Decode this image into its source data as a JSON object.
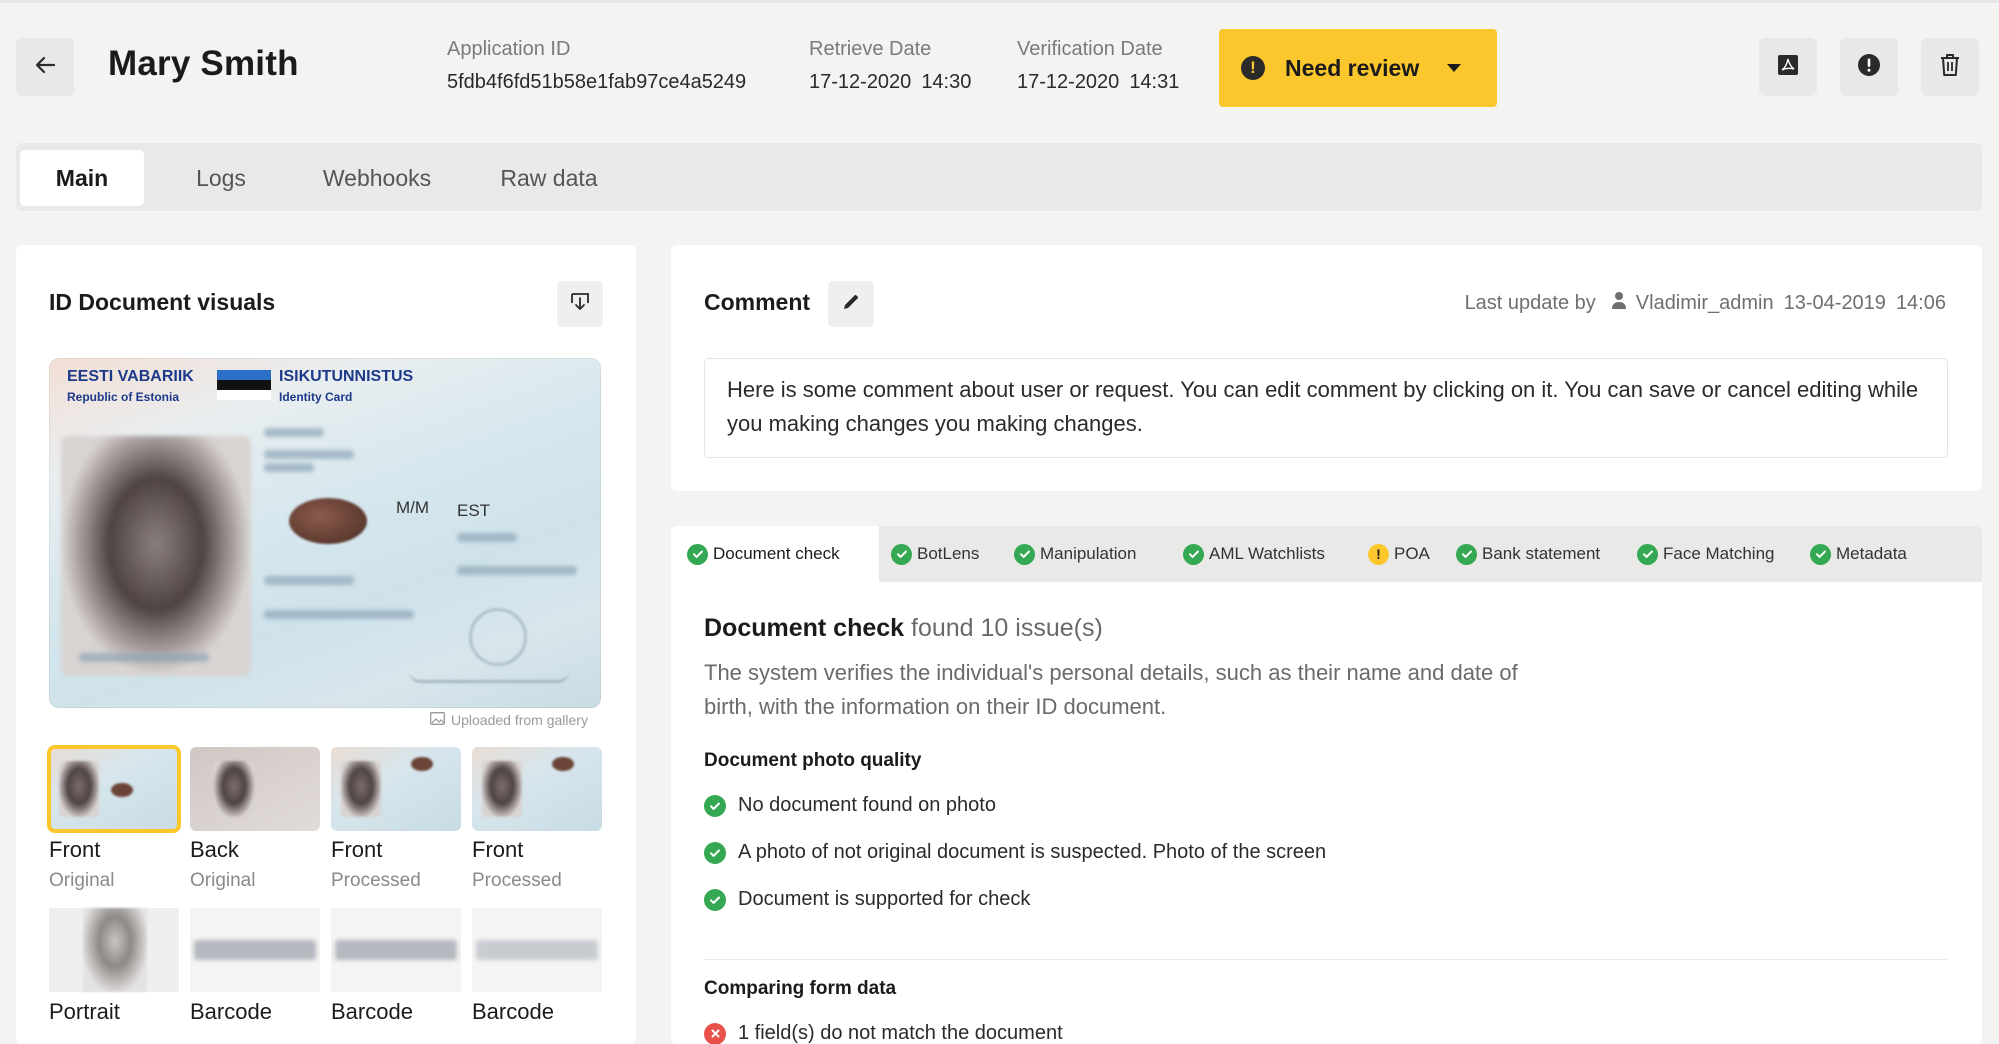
{
  "header": {
    "name": "Mary Smith",
    "application_id_label": "Application ID",
    "application_id": "5fdb4f6fd51b58e1fab97ce4a5249",
    "retrieve_date_label": "Retrieve Date",
    "retrieve_date": "17-12-2020",
    "retrieve_time": "14:30",
    "verification_date_label": "Verification Date",
    "verification_date": "17-12-2020",
    "verification_time": "14:31",
    "status_label": "Need review",
    "status_color": "#fcc72c",
    "icons": [
      "arrow-left-icon",
      "pdf-icon",
      "alert-icon",
      "trash-icon"
    ]
  },
  "tabs": [
    {
      "label": "Main",
      "active": true
    },
    {
      "label": "Logs",
      "active": false
    },
    {
      "label": "Webhooks",
      "active": false
    },
    {
      "label": "Raw data",
      "active": false
    }
  ],
  "visuals": {
    "title": "ID Document visuals",
    "card": {
      "country": "EESTI VABARIIK",
      "country_en": "Republic of Estonia",
      "doc_type": "ISIKUTUNNISTUS",
      "doc_type_en": "Identity Card",
      "sex": "M/M",
      "nationality": "EST"
    },
    "uploaded_note": "Uploaded from gallery",
    "thumbnails": [
      {
        "label": "Front",
        "sub": "Original",
        "selected": true
      },
      {
        "label": "Back",
        "sub": "Original",
        "selected": false
      },
      {
        "label": "Front",
        "sub": "Processed",
        "selected": false
      },
      {
        "label": "Front",
        "sub": "Processed",
        "selected": false
      }
    ],
    "extras": [
      {
        "label": "Portrait"
      },
      {
        "label": "Barcode"
      },
      {
        "label": "Barcode"
      },
      {
        "label": "Barcode"
      }
    ]
  },
  "comment": {
    "title": "Comment",
    "last_update_label": "Last update by",
    "user": "Vladimir_admin",
    "date": "13-04-2019",
    "time": "14:06",
    "text": "Here is some comment about user or request. You can edit comment by clicking on it. You can save or cancel editing while you making changes you making changes."
  },
  "checks": {
    "tabs": [
      {
        "label": "Document check",
        "status": "ok",
        "active": true
      },
      {
        "label": "BotLens",
        "status": "ok",
        "active": false
      },
      {
        "label": "Manipulation",
        "status": "ok",
        "active": false
      },
      {
        "label": "AML Watchlists",
        "status": "ok",
        "active": false
      },
      {
        "label": "POA",
        "status": "warn",
        "active": false
      },
      {
        "label": "Bank statement",
        "status": "ok",
        "active": false
      },
      {
        "label": "Face Matching",
        "status": "ok",
        "active": false
      },
      {
        "label": "Metadata",
        "status": "ok",
        "active": false
      }
    ],
    "title_bold": "Document check",
    "title_rest": "found 10 issue(s)",
    "description": "The system verifies the individual's personal details, such as their name and date of birth, with the information on their ID document.",
    "sections": [
      {
        "title": "Document photo quality",
        "items": [
          {
            "text": "No document found on photo",
            "status": "ok"
          },
          {
            "text": "A photo of not original document is suspected. Photo of the screen",
            "status": "ok"
          },
          {
            "text": "Document is supported for check",
            "status": "ok"
          }
        ]
      },
      {
        "title": "Comparing form data",
        "items": [
          {
            "text": "1 field(s) do not match the document",
            "status": "error"
          }
        ]
      }
    ],
    "status_colors": {
      "ok": "#34a853",
      "warn": "#fcc72c",
      "error": "#e8514a"
    }
  }
}
